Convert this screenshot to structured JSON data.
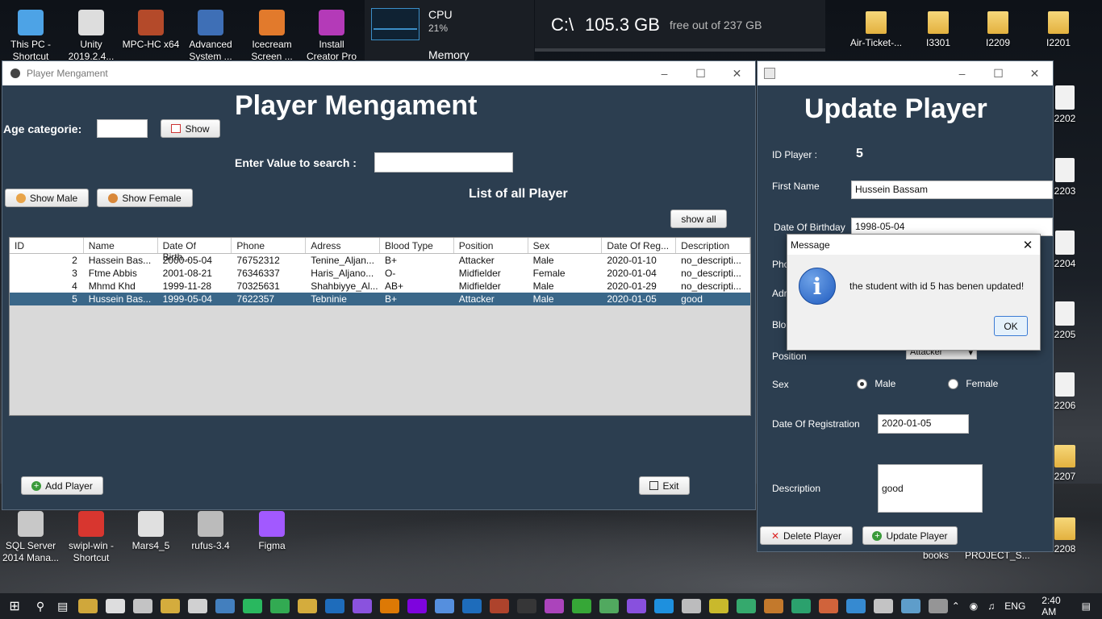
{
  "desktop": {
    "left_icons": [
      {
        "label": "This PC -\nShortcut",
        "icon": "computer-icon",
        "color": "#4da3e6"
      },
      {
        "label": "Unity\n2019.2.4...",
        "icon": "unity-icon",
        "color": "#dddddd"
      },
      {
        "label": "MPC-HC x64",
        "icon": "media-player-icon",
        "color": "#b44a2a"
      },
      {
        "label": "Advanced\nSystem ...",
        "icon": "shield-icon",
        "color": "#3e6fb6"
      },
      {
        "label": "Icecream\nScreen ...",
        "icon": "screen-recorder-icon",
        "color": "#e27a2c"
      },
      {
        "label": "Install\nCreator Pro",
        "icon": "installer-icon",
        "color": "#b43ab8"
      }
    ],
    "bottom_icons": [
      {
        "label": "SQL Server\n2014 Mana...",
        "icon": "sql-server-icon",
        "color": "#c8c8c8"
      },
      {
        "label": "swipl-win -\nShortcut",
        "icon": "owl-icon",
        "color": "#d8362f"
      },
      {
        "label": "Mars4_5",
        "icon": "java-icon",
        "color": "#e0e0e0"
      },
      {
        "label": "rufus-3.4",
        "icon": "usb-icon",
        "color": "#bbbbbb"
      },
      {
        "label": "Figma",
        "icon": "figma-icon",
        "color": "#a259ff"
      }
    ],
    "right_folders": [
      "Air-Ticket-...",
      "I3301",
      "I2209",
      "I2201"
    ],
    "right_side_labels": [
      "2202",
      "2203",
      "2204",
      "2205",
      "2206",
      "2207",
      "2208"
    ],
    "bottom_right_labels": [
      "books",
      "PROJECT_S..."
    ]
  },
  "cpu_widget": {
    "title": "CPU",
    "value": "21%",
    "memory": "Memory"
  },
  "disk_widget": {
    "drive": "C:\\",
    "size": "105.3 GB",
    "free_text": "free out of 237 GB"
  },
  "main_window": {
    "title": "Player Mengament",
    "heading": "Player Mengament",
    "age_label": "Age categorie:",
    "age_value": "",
    "show_button": "Show",
    "search_label": "Enter Value to search :",
    "search_value": "",
    "show_male": "Show Male",
    "show_female": "Show Female",
    "list_title": "List of all Player",
    "show_all": "show all",
    "add_player": "Add Player",
    "exit": "Exit"
  },
  "table": {
    "headers": [
      "ID",
      "Name",
      "Date Of Birth...",
      "Phone",
      "Adress",
      "Blood Type",
      "Position",
      "Sex",
      "Date Of Reg...",
      "Description"
    ],
    "rows": [
      [
        "2",
        "Hassein Bas...",
        "2000-05-04",
        "76752312",
        "Tenine_Aljan...",
        "B+",
        "Attacker",
        "Male",
        "2020-01-10",
        "no_descripti..."
      ],
      [
        "3",
        "Ftme Abbis",
        "2001-08-21",
        "76346337",
        "Haris_Aljano...",
        "O-",
        "Midfielder",
        "Female",
        "2020-01-04",
        "no_descripti..."
      ],
      [
        "4",
        "Mhmd Khd",
        "1999-11-28",
        "70325631",
        "Shahbiyye_Al...",
        "AB+",
        "Midfielder",
        "Male",
        "2020-01-29",
        "no_descripti..."
      ],
      [
        "5",
        "Hussein Bas...",
        "1999-05-04",
        "7622357",
        "Tebninie",
        "B+",
        "Attacker",
        "Male",
        "2020-01-05",
        "good"
      ]
    ],
    "selected_index": 3
  },
  "update_window": {
    "heading": "Update Player",
    "id_label": "ID Player :",
    "id_value": "5",
    "first_name_label": "First Name",
    "first_name_value": "Hussein Bassam",
    "dob_label": "Date Of Birthday",
    "dob_value": "1998-05-04",
    "phone_label_partial": "Pho",
    "address_label_partial": "Adr",
    "blood_label_partial": "Blo",
    "position_label": "Position",
    "position_value": "Attacker",
    "sex_label": "Sex",
    "sex_male": "Male",
    "sex_female": "Female",
    "sex_selected": "Male",
    "reg_label": "Date Of Registration",
    "reg_value": "2020-01-05",
    "description_label": "Description",
    "description_value": "good",
    "delete_button": "Delete Player",
    "update_button": "Update Player"
  },
  "dialog": {
    "title": "Message",
    "message": "the student with id 5 has benen updated!",
    "ok": "OK"
  },
  "taskbar": {
    "language": "ENG",
    "time": "2:40 AM"
  }
}
